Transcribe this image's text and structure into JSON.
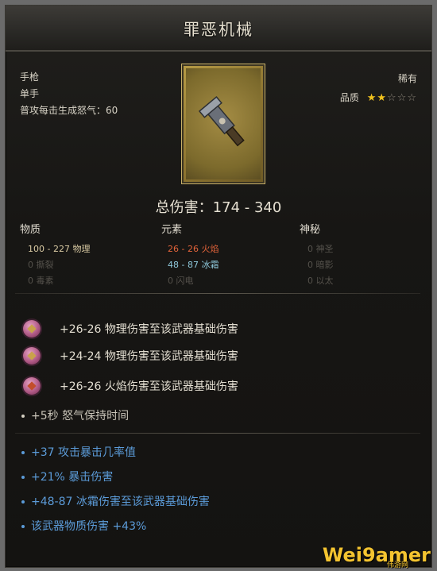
{
  "item": {
    "name": "罪恶机械",
    "type": "手枪",
    "hand": "单手",
    "rage_on_hit": "普攻每击生成怒气：60",
    "rarity": "稀有",
    "quality_label": "品质",
    "quality_stars": 2,
    "quality_max": 5,
    "total_damage": "总伤害：174 - 340"
  },
  "damage": {
    "headers": [
      "物质",
      "元素",
      "神秘"
    ],
    "physical": [
      "100 - 227 物理",
      "0 撕裂",
      "0 毒素"
    ],
    "elemental": [
      "26 - 26 火焰",
      "48 - 87 冰霜",
      "0 闪电"
    ],
    "arcane": [
      "0 神圣",
      "0 暗影",
      "0 以太"
    ]
  },
  "socket_affixes": [
    {
      "text": "+26-26 物理伤害至该武器基础伤害",
      "icon": "gem-icon"
    },
    {
      "text": "+24-24 物理伤害至该武器基础伤害",
      "icon": "gem-icon"
    },
    {
      "text": "+26-26 火焰伤害至该武器基础伤害",
      "icon": "fire-gem-icon"
    }
  ],
  "white_affix": "+5秒 怒气保持时间",
  "blue_affixes": [
    "+37 攻击暴击几率值",
    "+21% 暴击伤害",
    "+48-87 冰霜伤害至该武器基础伤害",
    "该武器物质伤害 +43%"
  ],
  "watermark": {
    "brand": "Wei9amer",
    "sub": "伟游网"
  },
  "colors": {
    "fire": "#e2633a",
    "frost": "#8ec7da",
    "magic": "#5b9bd8",
    "star": "#f0c21e"
  }
}
